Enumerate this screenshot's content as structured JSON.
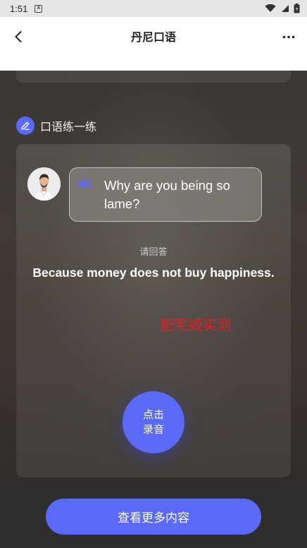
{
  "status_bar": {
    "time": "1:51",
    "notification_glyph": "A",
    "icons": [
      "wifi-icon",
      "signal-icon",
      "battery-icon"
    ]
  },
  "header": {
    "title": "丹尼口语",
    "back_icon": "chevron-left-icon",
    "more_icon": "more-horizontal-icon"
  },
  "section": {
    "title": "口语练一练",
    "icon": "pencil-icon"
  },
  "practice": {
    "question": "Why are you being so lame?",
    "prompt": "请回答",
    "answer": "Because money does not buy happiness.",
    "watermark": "肥宅姬实测",
    "record_label": "点击录音"
  },
  "footer": {
    "button_label": "查看更多内容"
  },
  "colors": {
    "accent": "#5a6af6",
    "watermark": "#e02020",
    "header_bg": "#ffffff",
    "status_bg": "#e6e6e6"
  }
}
